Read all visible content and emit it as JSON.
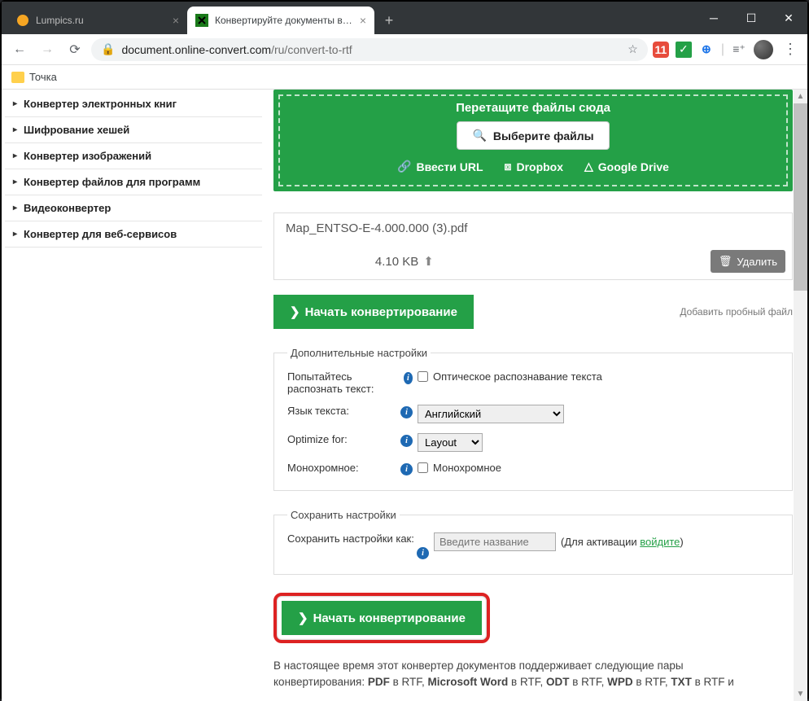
{
  "browser": {
    "tabs": [
      {
        "title": "Lumpics.ru",
        "active": false
      },
      {
        "title": "Конвертируйте документы в фо",
        "active": true
      }
    ],
    "urlDomain": "document.online-convert.com",
    "urlPath": "/ru/convert-to-rtf",
    "bookmark": "Точка",
    "extBadge": "11"
  },
  "sidebar": [
    "Конвертер электронных книг",
    "Шифрование хешей",
    "Конвертер изображений",
    "Конвертер файлов для программ",
    "Видеоконвертер",
    "Конвертер для веб-сервисов"
  ],
  "dropzone": {
    "title": "Перетащите файлы сюда",
    "selectBtn": "Выберите файлы",
    "urlLink": "Ввести URL",
    "dropboxLink": "Dropbox",
    "gdriveLink": "Google Drive"
  },
  "file": {
    "name": "Map_ENTSO-E-4.000.000 (3).pdf",
    "size": "4.10 KB",
    "deleteBtn": "Удалить"
  },
  "actions": {
    "startBtn": "Начать конвертирование",
    "addTestFile": "Добавить пробный файл"
  },
  "settings": {
    "legend": "Дополнительные настройки",
    "ocrLabel": "Попытайтесь распознать текст:",
    "ocrCheckbox": "Оптическое распознавание текста",
    "langLabel": "Язык текста:",
    "langValue": "Английский",
    "optimizeLabel": "Optimize for:",
    "optimizeValue": "Layout",
    "monoLabel": "Монохромное:",
    "monoCheckbox": "Монохромное"
  },
  "save": {
    "legend": "Сохранить настройки",
    "label": "Сохранить настройки как:",
    "placeholder": "Введите название",
    "helpPrefix": "(Для активации ",
    "helpLink": "войдите",
    "helpSuffix": ")"
  },
  "footer": {
    "line1": "В настоящее время этот конвертер документов поддерживает следующие пары",
    "line2a": "конвертирования: ",
    "pairs": [
      "PDF",
      "Microsoft Word",
      "ODT",
      "WPD",
      "TXT"
    ],
    "inRTF": " в RTF, ",
    "inRTFand": " в RTF и "
  }
}
